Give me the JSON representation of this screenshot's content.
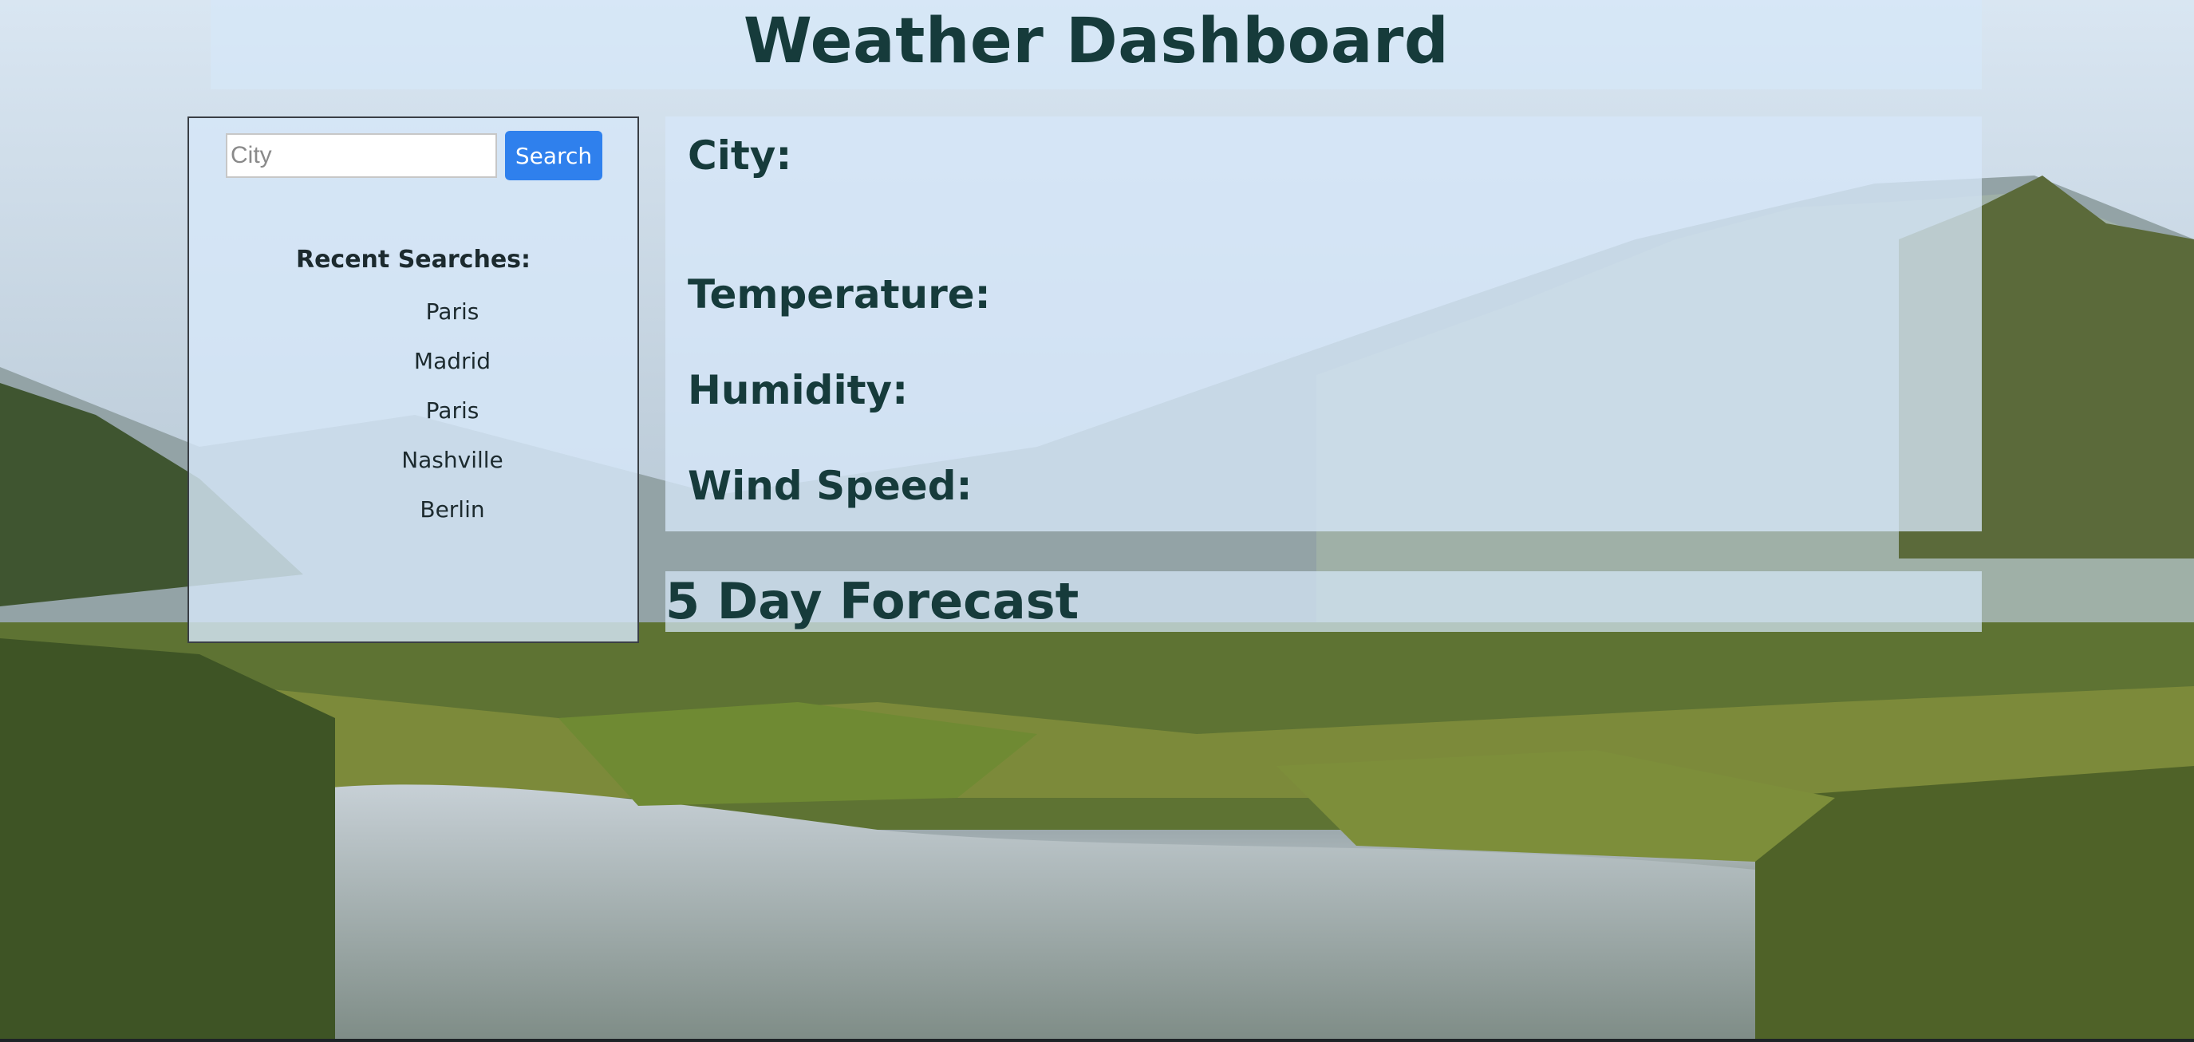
{
  "header": {
    "title": "Weather Dashboard"
  },
  "search": {
    "placeholder": "City",
    "button_label": "Search"
  },
  "recent": {
    "title": "Recent Searches:",
    "items": [
      "Paris",
      "Madrid",
      "Paris",
      "Nashville",
      "Berlin"
    ]
  },
  "current": {
    "city_label": "City:",
    "temperature_label": "Temperature:",
    "humidity_label": "Humidity:",
    "wind_label": "Wind Speed:"
  },
  "forecast": {
    "title": "5 Day Forecast"
  },
  "colors": {
    "accent": "#2f80ed",
    "heading": "#163b3b",
    "panel": "#d6e7f8"
  }
}
